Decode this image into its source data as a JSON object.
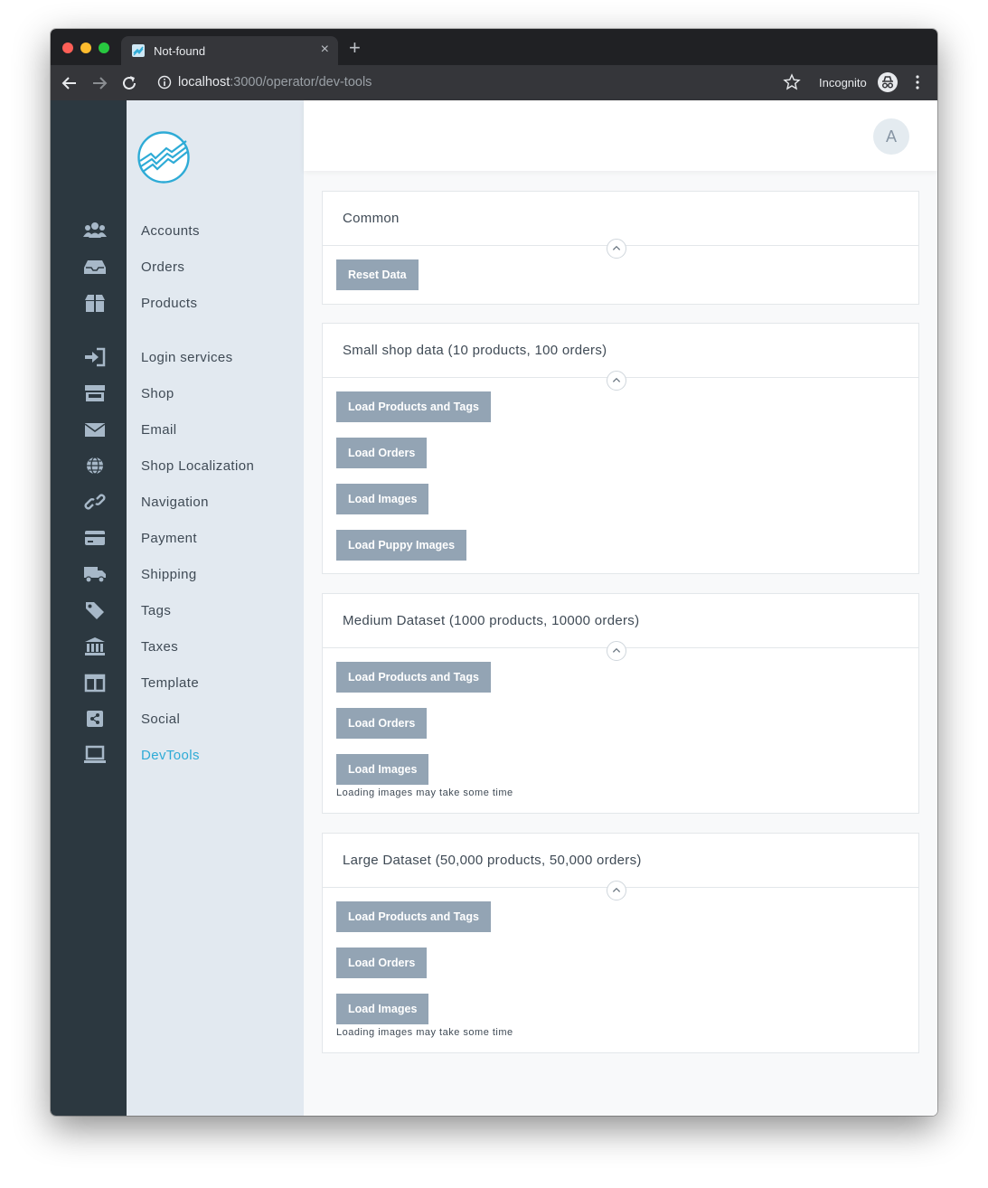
{
  "browser": {
    "tab_title": "Not-found",
    "new_tab_label": "+",
    "close_label": "×",
    "url_host": "localhost",
    "url_path": ":3000/operator/dev-tools",
    "incognito_label": "Incognito"
  },
  "header": {
    "avatar_initial": "A"
  },
  "sidebar": {
    "items": [
      {
        "label": "Accounts",
        "icon": "users-icon"
      },
      {
        "label": "Orders",
        "icon": "inbox-icon"
      },
      {
        "label": "Products",
        "icon": "box-icon"
      },
      {
        "label": "Login services",
        "icon": "sign-in-icon"
      },
      {
        "label": "Shop",
        "icon": "store-icon"
      },
      {
        "label": "Email",
        "icon": "envelope-icon"
      },
      {
        "label": "Shop Localization",
        "icon": "globe-icon"
      },
      {
        "label": "Navigation",
        "icon": "link-icon"
      },
      {
        "label": "Payment",
        "icon": "credit-card-icon"
      },
      {
        "label": "Shipping",
        "icon": "truck-icon"
      },
      {
        "label": "Tags",
        "icon": "tag-icon"
      },
      {
        "label": "Taxes",
        "icon": "bank-icon"
      },
      {
        "label": "Template",
        "icon": "columns-icon"
      },
      {
        "label": "Social",
        "icon": "share-icon"
      },
      {
        "label": "DevTools",
        "icon": "laptop-icon",
        "active": true
      }
    ]
  },
  "cards": [
    {
      "title": "Common",
      "buttons": [
        "Reset Data"
      ]
    },
    {
      "title": "Small shop data (10 products, 100 orders)",
      "buttons": [
        "Load Products and Tags",
        "Load Orders",
        "Load Images",
        "Load Puppy Images"
      ]
    },
    {
      "title": "Medium Dataset (1000 products, 10000 orders)",
      "buttons": [
        "Load Products and Tags",
        "Load Orders",
        "Load Images"
      ],
      "hint": "Loading images may take some time"
    },
    {
      "title": "Large Dataset (50,000 products, 50,000 orders)",
      "buttons": [
        "Load Products and Tags",
        "Load Orders",
        "Load Images"
      ],
      "hint": "Loading images may take some time"
    }
  ],
  "colors": {
    "rail_bg": "#2c3840",
    "nav_bg": "#e2e9f0",
    "icon": "#a7b8c8",
    "active": "#2eabd6",
    "button_bg": "#93a4b4"
  }
}
